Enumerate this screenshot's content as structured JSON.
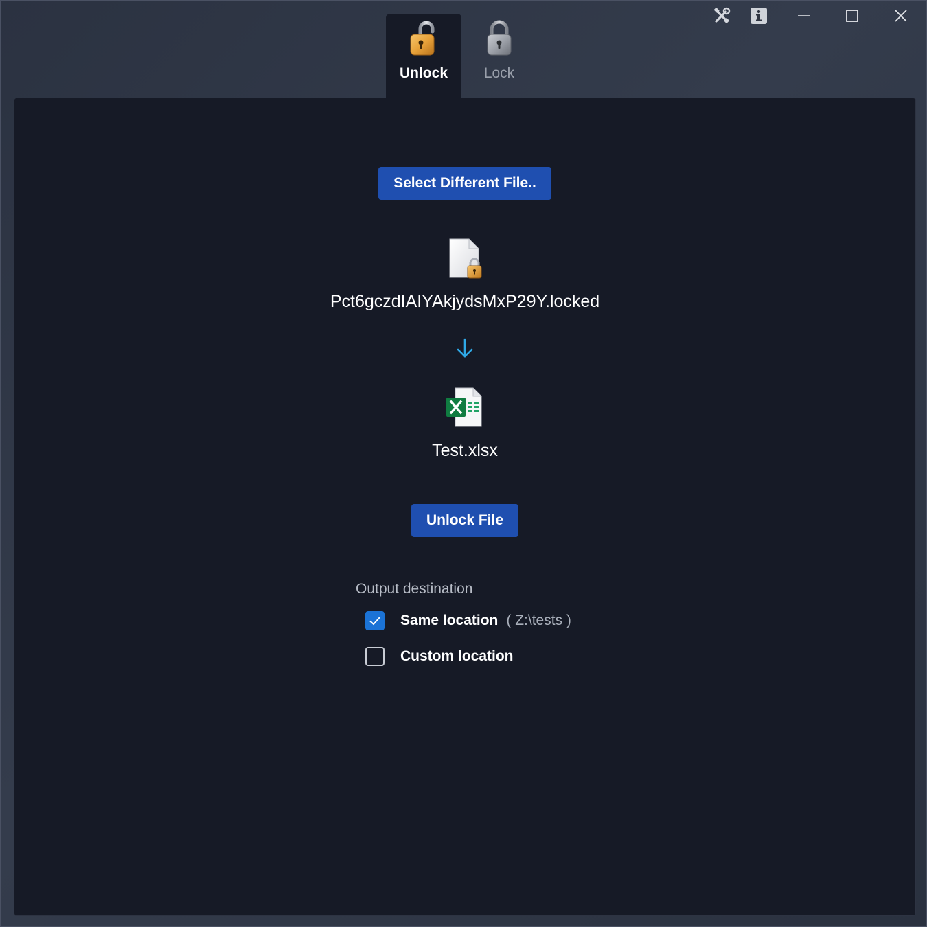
{
  "tabs": [
    {
      "label": "Unlock",
      "icon": "unlocked-padlock-icon",
      "active": true
    },
    {
      "label": "Lock",
      "icon": "locked-padlock-icon",
      "active": false
    }
  ],
  "toolbar": {
    "settings_icon": "tools-icon",
    "info_icon": "info-icon"
  },
  "window_controls": {
    "minimize_icon": "minimize-icon",
    "maximize_icon": "maximize-icon",
    "close_icon": "close-icon"
  },
  "main": {
    "select_button_label": "Select Different File..",
    "source_file": {
      "name": "Pct6gczdIAIYAkjydsMxP29Y.locked",
      "icon": "locked-file-icon"
    },
    "arrow_icon": "arrow-down-icon",
    "output_file": {
      "name": "Test.xlsx",
      "icon": "excel-file-icon"
    },
    "unlock_button_label": "Unlock File"
  },
  "output": {
    "section_label": "Output destination",
    "options": [
      {
        "label": "Same location",
        "hint": "( Z:\\tests )",
        "checked": true
      },
      {
        "label": "Custom location",
        "hint": "",
        "checked": false
      }
    ]
  },
  "colors": {
    "accent": "#1f4fb0",
    "checkbox_accent": "#1b73d6",
    "panel_bg": "#161a26",
    "arrow": "#2fa8e6"
  }
}
